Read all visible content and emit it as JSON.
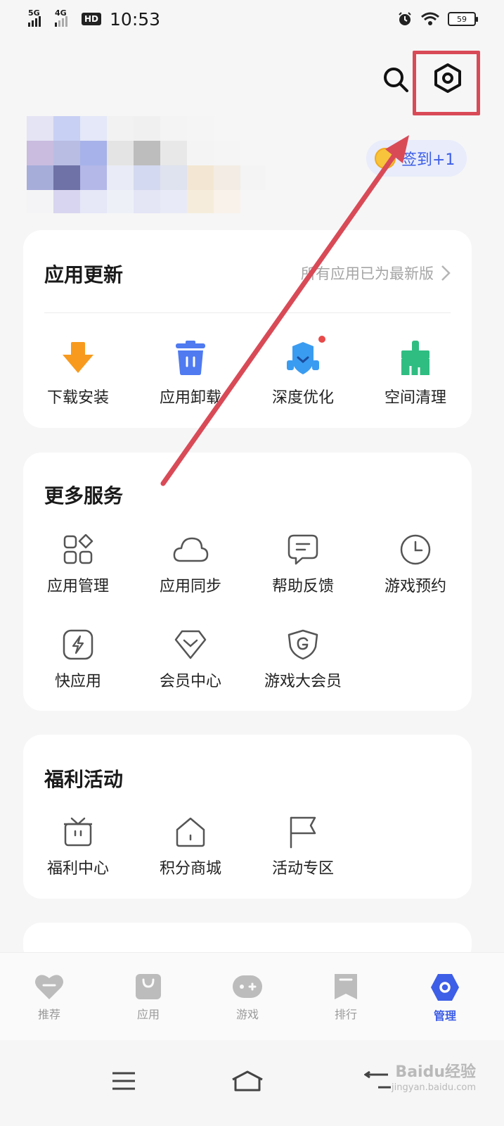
{
  "status_bar": {
    "network_1": "5G",
    "network_2": "4G",
    "hd": "HD",
    "time": "10:53",
    "battery": "59"
  },
  "header": {
    "search_icon": "search-icon",
    "settings_icon": "settings-hexagon-icon"
  },
  "checkin": {
    "label": "签到+1"
  },
  "app_update": {
    "title": "应用更新",
    "status": "所有应用已为最新版",
    "items": [
      {
        "label": "下载安装",
        "icon": "download-arrow-icon",
        "color": "#f79a1e"
      },
      {
        "label": "应用卸载",
        "icon": "trash-icon",
        "color": "#4f7af0"
      },
      {
        "label": "深度优化",
        "icon": "optimize-shield-icon",
        "color": "#3a9cf0"
      },
      {
        "label": "空间清理",
        "icon": "broom-icon",
        "color": "#2fbd82"
      }
    ]
  },
  "more_services": {
    "title": "更多服务",
    "items": [
      {
        "label": "应用管理",
        "icon": "app-grid-icon"
      },
      {
        "label": "应用同步",
        "icon": "cloud-icon"
      },
      {
        "label": "帮助反馈",
        "icon": "chat-bubble-icon"
      },
      {
        "label": "游戏预约",
        "icon": "clock-icon"
      },
      {
        "label": "快应用",
        "icon": "lightning-icon"
      },
      {
        "label": "会员中心",
        "icon": "diamond-heart-icon"
      },
      {
        "label": "游戏大会员",
        "icon": "g-shield-icon"
      }
    ]
  },
  "welfare": {
    "title": "福利活动",
    "items": [
      {
        "label": "福利中心",
        "icon": "gift-box-icon"
      },
      {
        "label": "积分商城",
        "icon": "house-icon"
      },
      {
        "label": "活动专区",
        "icon": "flag-icon"
      }
    ]
  },
  "tabbar": {
    "tabs": [
      {
        "label": "推荐",
        "icon": "heart-icon"
      },
      {
        "label": "应用",
        "icon": "bag-icon"
      },
      {
        "label": "游戏",
        "icon": "gamepad-icon"
      },
      {
        "label": "排行",
        "icon": "bookmark-icon"
      },
      {
        "label": "管理",
        "icon": "manage-hexagon-icon",
        "active": true
      }
    ]
  },
  "watermark": {
    "text": "Baidu经验",
    "sub": "jingyan.baidu.com"
  },
  "colors": {
    "accent": "#3d5ee6",
    "annotation": "#d94a57"
  }
}
